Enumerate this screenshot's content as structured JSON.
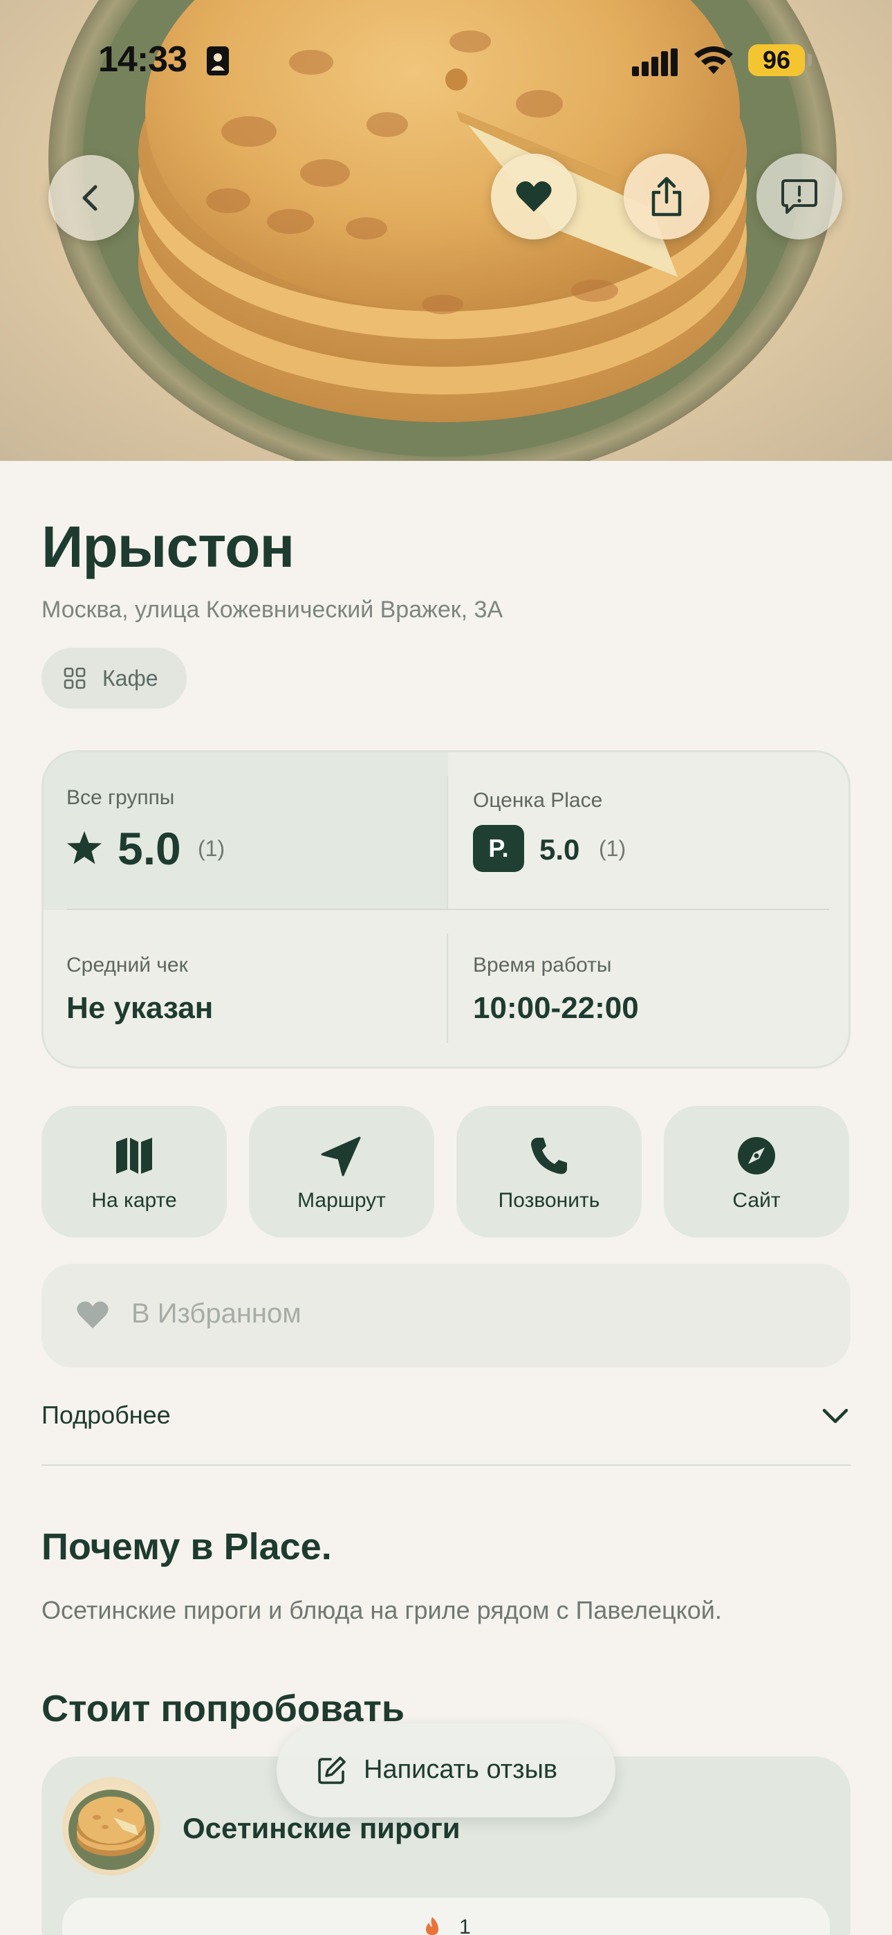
{
  "status_bar": {
    "time": "14:33",
    "battery": "96"
  },
  "hero": {
    "icons": {
      "back": "chevron-left-icon",
      "favorite": "heart-icon",
      "share": "share-icon",
      "report": "report-icon"
    }
  },
  "place": {
    "name": "Ирыстон",
    "address": "Москва, улица Кожевнический Вражек, 3А",
    "category": "Кафе"
  },
  "info": {
    "all_groups_label": "Все группы",
    "all_groups_rating": "5.0",
    "all_groups_count": "(1)",
    "place_rating_label": "Оценка Place",
    "place_logo_letter": "P.",
    "place_rating": "5.0",
    "place_rating_count": "(1)",
    "avg_check_label": "Средний чек",
    "avg_check_value": "Не указан",
    "hours_label": "Время работы",
    "hours_value": "10:00-22:00"
  },
  "actions": [
    {
      "label": "На карте",
      "icon": "map-icon"
    },
    {
      "label": "Маршрут",
      "icon": "navigation-arrow-icon"
    },
    {
      "label": "Позвонить",
      "icon": "phone-icon"
    },
    {
      "label": "Сайт",
      "icon": "compass-icon"
    }
  ],
  "favorite": {
    "label": "В Избранном"
  },
  "more": {
    "label": "Подробнее"
  },
  "why": {
    "title": "Почему в Place.",
    "text": "Осетинские пироги и блюда на гриле рядом с Павелецкой."
  },
  "try_section": {
    "title": "Стоит попробовать",
    "dish_name": "Осетинские пироги",
    "count": "1"
  },
  "review_button": {
    "label": "Написать отзыв"
  },
  "colors": {
    "primary": "#1e3b2f",
    "background": "#f6f3ee",
    "chip": "#e2e7e0",
    "battery": "#f4c531"
  }
}
